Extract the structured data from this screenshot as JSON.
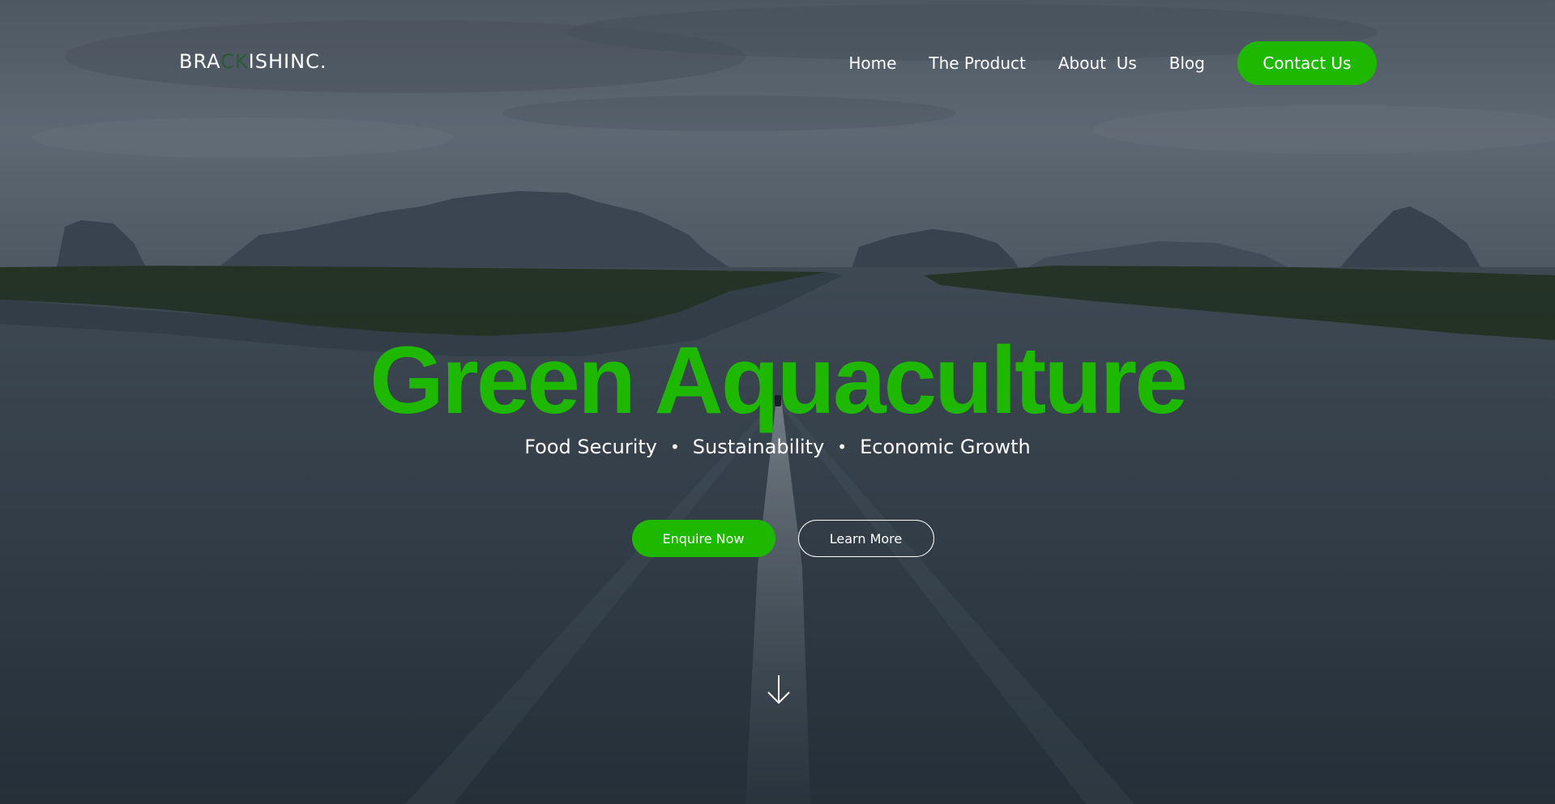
{
  "header": {
    "logo": {
      "part1": "BRA",
      "part2": "CK",
      "part3": "ISHINC."
    },
    "nav": {
      "home": "Home",
      "product": "The Product",
      "about": "About  Us",
      "blog": "Blog",
      "contact": "Contact Us"
    }
  },
  "hero": {
    "title": "Green Aquaculture",
    "tagline": {
      "item1": "Food Security",
      "item2": "Sustainability",
      "item3": "Economic Growth",
      "separator": "•"
    },
    "enquire_label": "Enquire Now",
    "learn_label": "Learn More",
    "scroll_icon": "arrow-down-icon"
  },
  "colors": {
    "accent": "#1fb800",
    "text": "#ffffff",
    "logo_accent": "#2a5a34"
  }
}
